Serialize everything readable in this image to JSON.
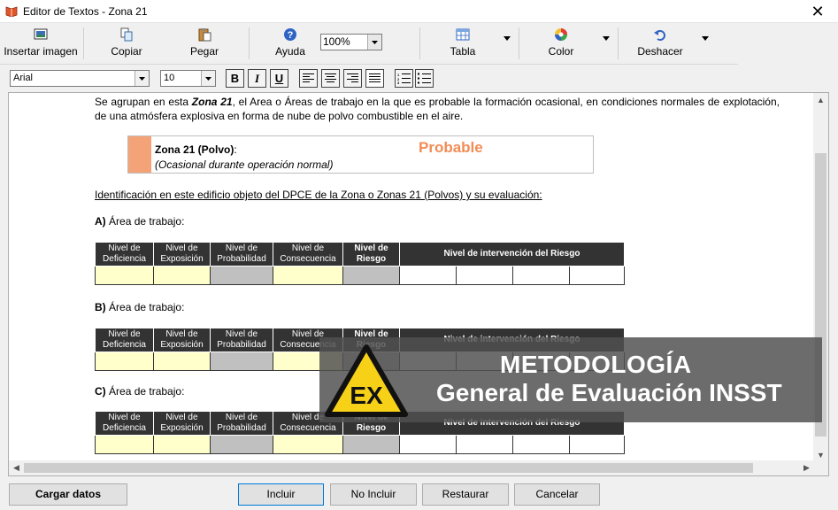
{
  "window": {
    "title": "Editor de Textos - Zona 21"
  },
  "toolbar": {
    "insert_image": "Insertar imagen",
    "copy": "Copiar",
    "paste": "Pegar",
    "help": "Ayuda",
    "zoom": "100%",
    "table": "Tabla",
    "color": "Color",
    "undo": "Deshacer"
  },
  "format": {
    "font": "Arial",
    "size": "10",
    "bold": "B",
    "italic": "I",
    "underline": "U"
  },
  "document": {
    "intro_pre": "Se agrupan en esta ",
    "intro_zone": "Zona 21",
    "intro_post": ", el Area o Áreas de trabajo en la que es probable la formación ocasional, en condiciones normales de explotación, de una atmósfera explosiva en forma de nube de polvo combustible en el aire.",
    "zone_name": "Zona 21 (Polvo)",
    "zone_colon": ":",
    "zone_desc": "(Ocasional durante operación normal)",
    "zone_probability": "Probable",
    "identification": "Identificación en este edificio objeto del DPCE de la Zona o Zonas 21 (Polvos) y su evaluación:",
    "area_suffix": "Área de trabajo:",
    "areas": [
      "A)",
      "B)",
      "C)"
    ],
    "table_headers": {
      "deficiencia": [
        "Nivel de",
        "Deficiencia"
      ],
      "exposicion": [
        "Nivel de",
        "Exposición"
      ],
      "probabilidad": [
        "Nivel de",
        "Probabilidad"
      ],
      "consecuencia": [
        "Nivel de",
        "Consecuencia"
      ],
      "riesgo": [
        "Nivel de",
        "Riesgo"
      ],
      "intervencion": "Nivel de intervención del Riesgo"
    }
  },
  "overlay": {
    "line1": "METODOLOGÍA",
    "line2": "General de Evaluación INSST",
    "logo_text": "EX"
  },
  "buttons": {
    "load": "Cargar datos",
    "include": "Incluir",
    "exclude": "No Incluir",
    "restore": "Restaurar",
    "cancel": "Cancelar"
  },
  "colors": {
    "zone_swatch": "#f4a378",
    "probable": "#f28c55",
    "cell_yellow": "#ffffcc",
    "cell_gray": "#c0c0c0",
    "header_dark": "#333333",
    "ex_yellow": "#f7d117"
  }
}
